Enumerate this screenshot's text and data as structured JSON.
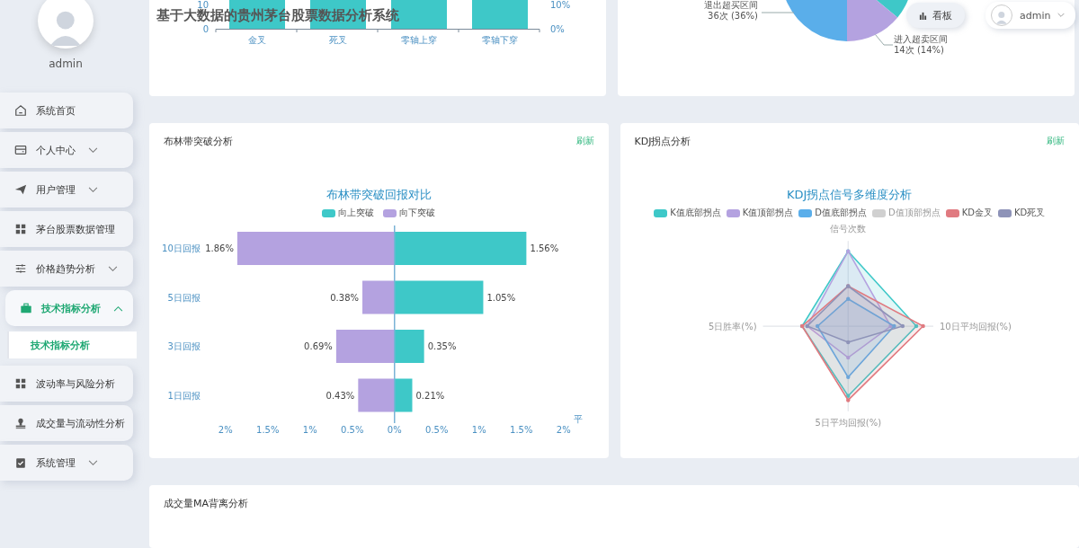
{
  "header": {
    "title": "基于大数据的贵州茅台股票数据分析系统",
    "dashboard_button": "看板",
    "user": "admin"
  },
  "sidebar": {
    "user": "admin",
    "items": [
      {
        "label": "系统首页",
        "kind": "link",
        "selected": false
      },
      {
        "label": "个人中心",
        "kind": "group",
        "expanded": false,
        "selected": false
      },
      {
        "label": "用户管理",
        "kind": "group",
        "expanded": false,
        "selected": false
      },
      {
        "label": "茅台股票数据管理",
        "kind": "link",
        "selected": false
      },
      {
        "label": "价格趋势分析",
        "kind": "group",
        "expanded": false,
        "selected": false
      },
      {
        "label": "技术指标分析",
        "kind": "group",
        "expanded": true,
        "selected": true,
        "children": [
          {
            "label": "技术指标分析",
            "selected": true
          }
        ]
      },
      {
        "label": "波动率与风险分析",
        "kind": "link",
        "selected": false
      },
      {
        "label": "成交量与流动性分析",
        "kind": "link",
        "selected": false
      },
      {
        "label": "系统管理",
        "kind": "group",
        "expanded": false,
        "selected": false
      }
    ]
  },
  "cross_card": {
    "y_ticks": [
      "10",
      "0"
    ],
    "y2_ticks": [
      "10%",
      "0%"
    ],
    "categories": [
      "金叉",
      "死叉",
      "零轴上穿",
      "零轴下穿"
    ]
  },
  "pie_card": {
    "labels": [
      {
        "name": "退出超买区间",
        "reading": "36次 (36%)"
      },
      {
        "name": "进入超卖区间",
        "reading": "14次 (14%)"
      }
    ]
  },
  "bollinger_card": {
    "title": "布林带突破分析",
    "refresh": "刷新",
    "chart_data": {
      "type": "bar",
      "orientation": "horizontal",
      "title": "布林带突破回报对比",
      "xlabel": "平",
      "categories": [
        "10日回报",
        "5日回报",
        "3日回报",
        "1日回报"
      ],
      "series": [
        {
          "name": "向上突破",
          "color": "#3ec8c8",
          "values": [
            1.56,
            1.05,
            0.35,
            0.21
          ]
        },
        {
          "name": "向下突破",
          "color": "#b4a2e0",
          "values": [
            -1.86,
            -0.38,
            -0.69,
            -0.43
          ]
        }
      ],
      "xlim": [
        -2,
        2
      ],
      "xticks": [
        {
          "value": -2,
          "label": "2%"
        },
        {
          "value": -1.5,
          "label": "1.5%"
        },
        {
          "value": -1,
          "label": "1%"
        },
        {
          "value": -0.5,
          "label": "0.5%"
        },
        {
          "value": 0,
          "label": "0%"
        },
        {
          "value": 0.5,
          "label": "0.5%"
        },
        {
          "value": 1,
          "label": "1%"
        },
        {
          "value": 1.5,
          "label": "1.5%"
        },
        {
          "value": 2,
          "label": "2%"
        }
      ],
      "ref_lines": [
        {
          "axis": "x",
          "value": 0
        }
      ],
      "stacked": true,
      "value_labels": [
        [
          "1.56%",
          "1.05%",
          "0.35%",
          "0.21%"
        ],
        [
          "1.86%",
          "0.38%",
          "0.69%",
          "0.43%"
        ]
      ]
    }
  },
  "kdj_card": {
    "title": "KDJ拐点分析",
    "refresh": "刷新",
    "chart": {
      "title": "KDJ拐点信号多维度分析",
      "legend": [
        {
          "label": "K值底部拐点",
          "color": "#3ec8c8",
          "shown": true
        },
        {
          "label": "K值顶部拐点",
          "color": "#b4a2e0",
          "shown": true
        },
        {
          "label": "D值底部拐点",
          "color": "#5aaeea",
          "shown": true
        },
        {
          "label": "D值顶部拐点",
          "shown": false
        },
        {
          "label": "KD金叉",
          "color": "#e07a80",
          "shown": true
        },
        {
          "label": "KD死叉",
          "color": "#8e93b8",
          "shown": true
        }
      ],
      "axes": [
        "信号次数",
        "10日平均回报(%)",
        "5日平均回报(%)",
        "5日胜率(%)"
      ]
    }
  },
  "volume_card": {
    "title": "成交量MA背离分析"
  }
}
